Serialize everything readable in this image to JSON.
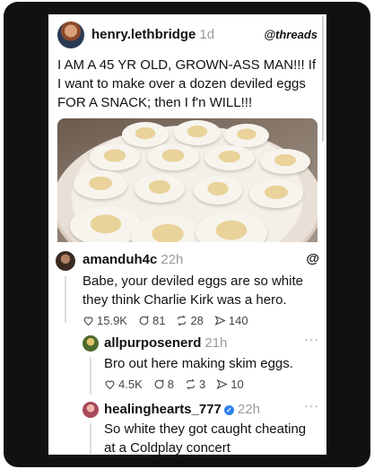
{
  "post": {
    "username": "henry.lethbridge",
    "time": "1d",
    "brand": "threads",
    "text": "I AM A 45 YR OLD, GROWN-ASS MAN!!! If I want to make over a dozen deviled eggs FOR A SNACK; then I f'n WILL!!!"
  },
  "replies": [
    {
      "username": "amanduh4c",
      "time": "22h",
      "text": "Babe, your deviled eggs are so white they think Charlie Kirk was a hero.",
      "likes": "15.9K",
      "comments": "81",
      "reposts": "28",
      "shares": "140"
    },
    {
      "username": "allpurposenerd",
      "time": "21h",
      "text": "Bro out here making skim eggs.",
      "likes": "4.5K",
      "comments": "8",
      "reposts": "3",
      "shares": "10"
    },
    {
      "username": "healinghearts_777",
      "time": "22h",
      "text": "So white they got caught cheating at a Coldplay concert"
    }
  ],
  "icons": {
    "more": "more-icon",
    "like": "heart-icon",
    "comment": "comment-icon",
    "repost": "repost-icon",
    "share": "share-icon",
    "brand": "threads-logo-icon",
    "verified": "verified-badge-icon"
  },
  "colors": {
    "frame": "#111111",
    "card": "#ffffff",
    "muted": "#9a9a9a",
    "verified": "#2f80ed"
  }
}
